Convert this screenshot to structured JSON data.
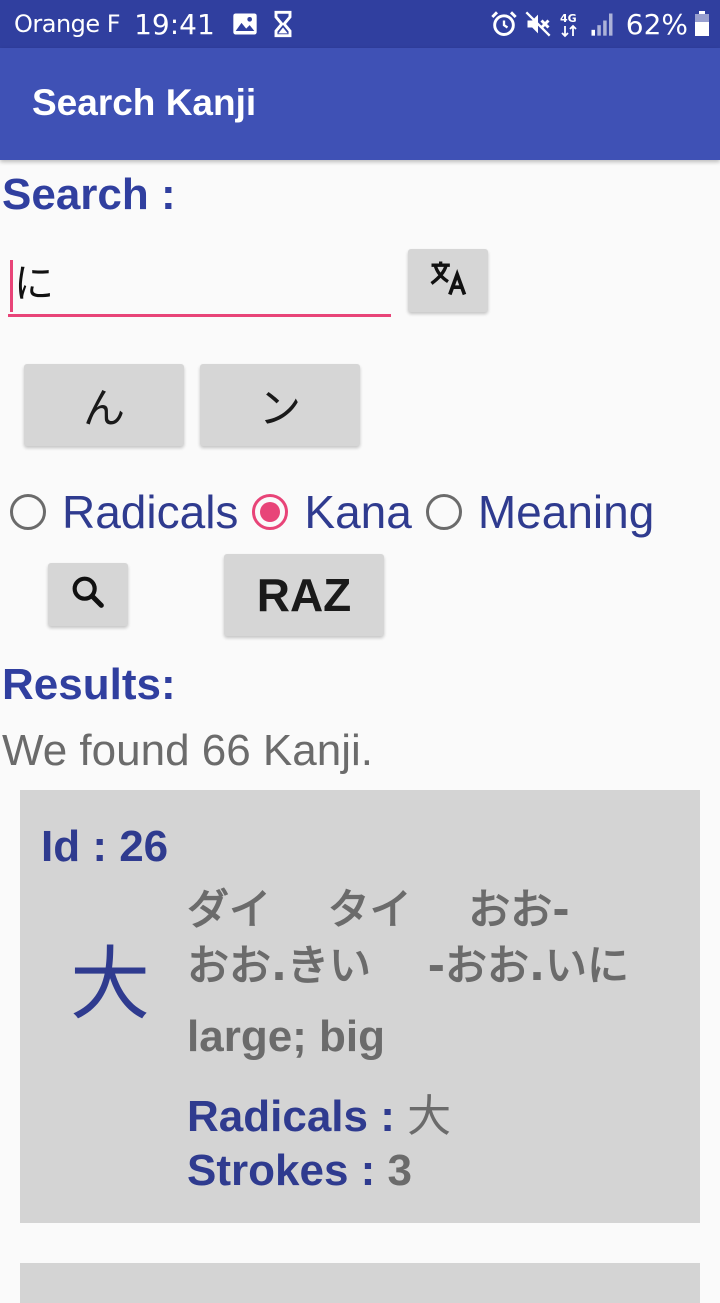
{
  "status_bar": {
    "carrier": "Orange F",
    "time": "19:41",
    "battery": "62%",
    "network": "4G",
    "icons_left": [
      "image-icon",
      "hourglass-icon"
    ],
    "icons_right": [
      "alarm-icon",
      "mute-icon",
      "signal-icon",
      "battery-icon"
    ]
  },
  "app_bar": {
    "title": "Search Kanji"
  },
  "search": {
    "label": "Search :",
    "value": "に",
    "translate_icon": "translate-icon",
    "kana_buttons": [
      "ん",
      "ン"
    ],
    "modes": [
      {
        "label": "Radicals",
        "checked": false
      },
      {
        "label": "Kana",
        "checked": true
      },
      {
        "label": "Meaning",
        "checked": false
      }
    ],
    "search_icon": "search-icon",
    "reset_label": "RAZ"
  },
  "results": {
    "label": "Results:",
    "summary": "We found 66 Kanji.",
    "items": [
      {
        "id_label": "Id : 26",
        "kanji": "大",
        "readings": "ダイ　 タイ　 おお-\nおお.きい　 -おお.いに",
        "meaning": "large;  big",
        "radicals_label": "Radicals : ",
        "radicals_value": "大",
        "strokes_label": "Strokes : ",
        "strokes_value": "3"
      }
    ]
  },
  "colors": {
    "status_bar": "#303f9f",
    "app_bar": "#3f51b5",
    "accent": "#e84478",
    "label_text": "#2f3b8f",
    "card_bg": "#d4d4d4"
  }
}
